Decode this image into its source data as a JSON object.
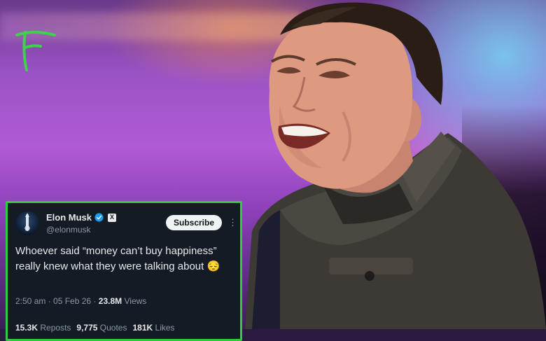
{
  "colors": {
    "card_border": "#35c845",
    "card_background": "#141b24",
    "logo_green": "#3fd14a",
    "verified_blue": "#1d9bf0",
    "text_primary": "#e7e9ea",
    "text_secondary": "#8b98a5"
  },
  "logo": {
    "icon": "stylized-f-logo-icon"
  },
  "tweet": {
    "author": {
      "name": "Elon Musk",
      "handle": "@elonmusk",
      "verified_icon": "verified-badge-icon",
      "affiliation_icon": "x-logo-icon",
      "affiliation_label": "X"
    },
    "subscribe_label": "Subscribe",
    "more_label": "⋮",
    "text": "Whoever said “money can’t buy happiness” really knew what they were talking about 😔",
    "time": "2:50 am",
    "separator": "·",
    "date": "05 Feb 26",
    "views": "23.8M",
    "views_label": "Views",
    "stats": [
      {
        "value": "15.3K",
        "label": "Reposts"
      },
      {
        "value": "9,775",
        "label": "Quotes"
      },
      {
        "value": "181K",
        "label": "Likes"
      }
    ]
  }
}
